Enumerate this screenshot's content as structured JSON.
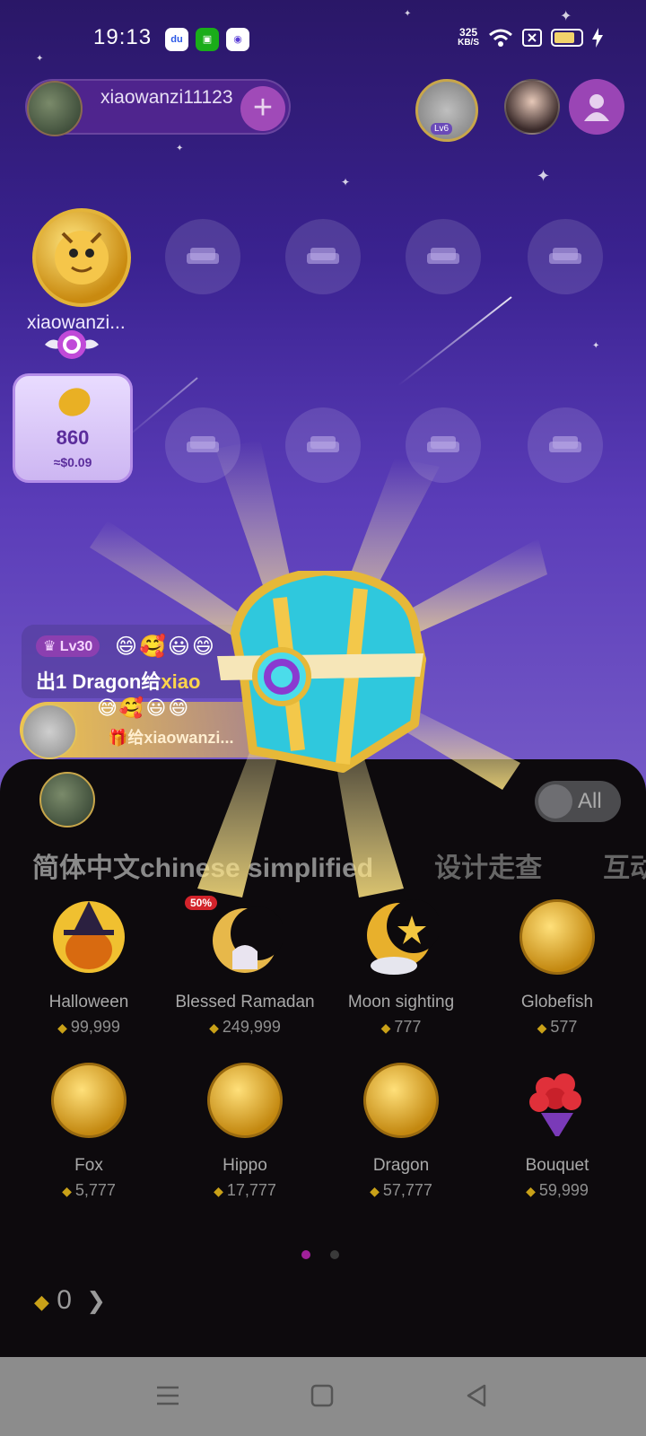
{
  "status_bar": {
    "time": "19:13",
    "net_speed_value": "325",
    "net_speed_unit": "KB/S",
    "apps": [
      "baidu-icon",
      "wechat-icon",
      "browser-icon"
    ]
  },
  "room": {
    "owner_name": "xiaowanzi11123",
    "host_level_badge": "Lv6",
    "host_seat_name": "xiaowanzi..."
  },
  "bean_card": {
    "amount": "860",
    "usd": "≈$0.09"
  },
  "chat": {
    "level": "Lv30",
    "message_prefix": "出1 Dragon给",
    "message_target": "xiao",
    "gift_line": "🎁给xiaowanzi..."
  },
  "gift_panel": {
    "toggle_label": "All",
    "tabs": [
      "简体中文chinese simplified",
      "设计走查",
      "互动"
    ],
    "gifts": [
      {
        "name": "Halloween",
        "price": "99,999"
      },
      {
        "name": "Blessed Ramadan",
        "price": "249,999",
        "badge": "50%"
      },
      {
        "name": "Moon sighting",
        "price": "777"
      },
      {
        "name": "Globefish",
        "price": "577"
      },
      {
        "name": "Fox",
        "price": "5,777"
      },
      {
        "name": "Hippo",
        "price": "17,777"
      },
      {
        "name": "Dragon",
        "price": "57,777"
      },
      {
        "name": "Bouquet",
        "price": "59,999"
      }
    ],
    "page_count": 2,
    "current_page": 1,
    "balance": "0"
  },
  "colors": {
    "accent_purple": "#9a45b5",
    "gold": "#c9a118",
    "panel_bg": "#0d0a0d"
  }
}
